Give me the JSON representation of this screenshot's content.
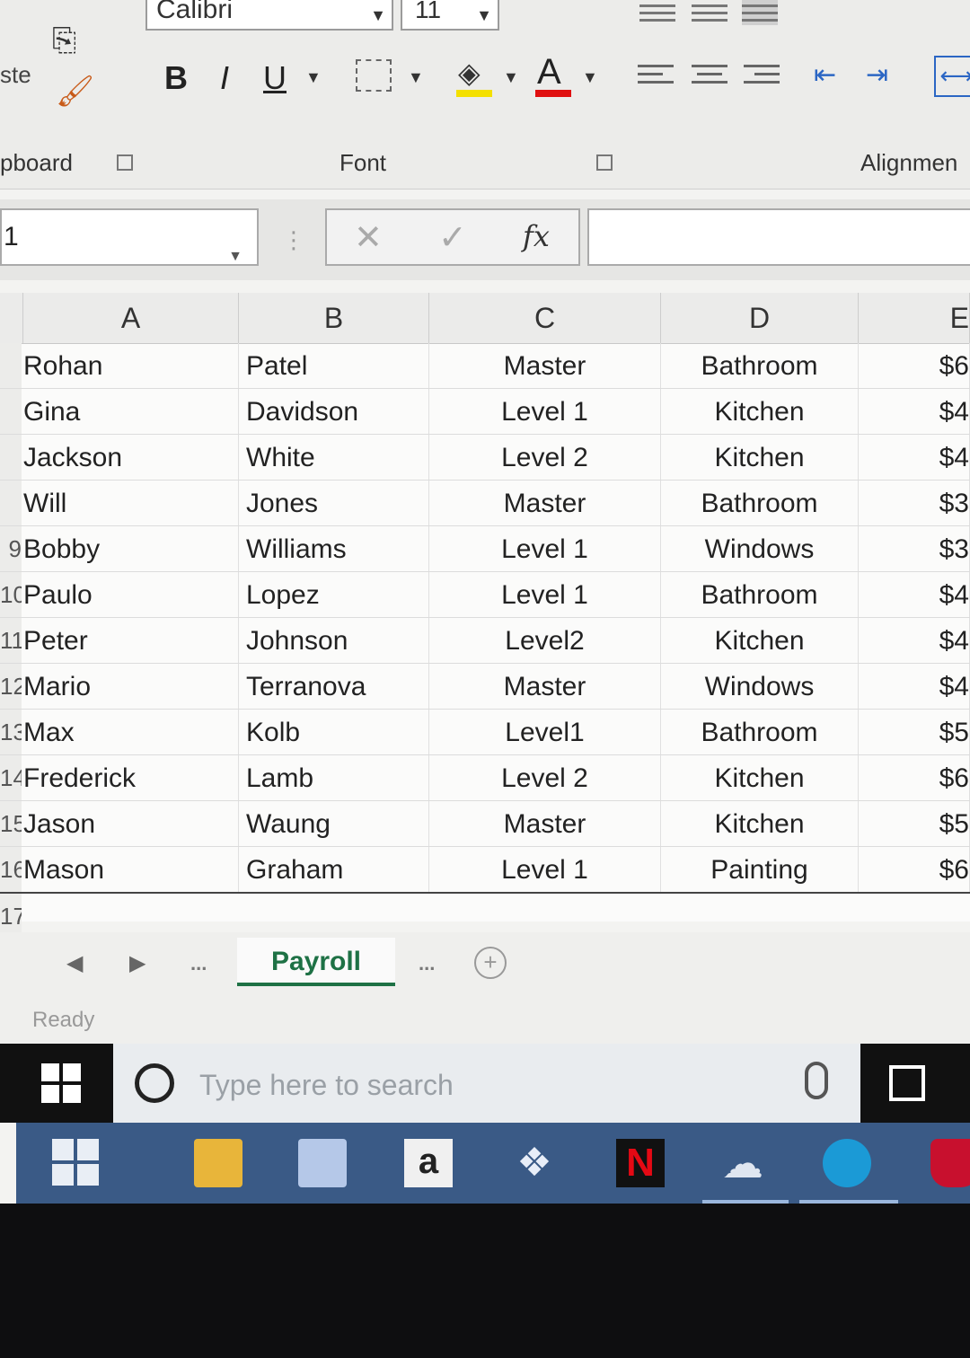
{
  "ribbon": {
    "font_name": "Calibri",
    "font_size": "11",
    "paste_label": "ste",
    "bold_label": "B",
    "italic_label": "I",
    "underline_label": "U",
    "font_color_label": "A",
    "wrap_label": "⟷",
    "groups": {
      "clipboard": "pboard",
      "font": "Font",
      "alignment": "Alignmen"
    }
  },
  "formula_bar": {
    "name_box": "1",
    "cancel": "✕",
    "enter": "✓",
    "fx": "fx",
    "value": ""
  },
  "columns": [
    "A",
    "B",
    "C",
    "D",
    "E"
  ],
  "rows": [
    {
      "num": "",
      "a": "Rohan",
      "b": "Patel",
      "c": "Master",
      "d": "Bathroom",
      "e": "$6"
    },
    {
      "num": "",
      "a": "Gina",
      "b": "Davidson",
      "c": "Level 1",
      "d": "Kitchen",
      "e": "$4"
    },
    {
      "num": "",
      "a": "Jackson",
      "b": "White",
      "c": "Level 2",
      "d": "Kitchen",
      "e": "$4"
    },
    {
      "num": "",
      "a": "Will",
      "b": "Jones",
      "c": "Master",
      "d": "Bathroom",
      "e": "$3"
    },
    {
      "num": "9",
      "a": "Bobby",
      "b": "Williams",
      "c": "Level 1",
      "d": "Windows",
      "e": "$3"
    },
    {
      "num": "10",
      "a": "Paulo",
      "b": "Lopez",
      "c": "Level 1",
      "d": "Bathroom",
      "e": "$4"
    },
    {
      "num": "11",
      "a": "Peter",
      "b": "Johnson",
      "c": "Level2",
      "d": "Kitchen",
      "e": "$4"
    },
    {
      "num": "12",
      "a": "Mario",
      "b": "Terranova",
      "c": "Master",
      "d": "Windows",
      "e": "$4"
    },
    {
      "num": "13",
      "a": "Max",
      "b": "Kolb",
      "c": "Level1",
      "d": "Bathroom",
      "e": "$5"
    },
    {
      "num": "14",
      "a": "Frederick",
      "b": "Lamb",
      "c": "Level 2",
      "d": "Kitchen",
      "e": "$6"
    },
    {
      "num": "15",
      "a": "Jason",
      "b": "Waung",
      "c": "Master",
      "d": "Kitchen",
      "e": "$5"
    },
    {
      "num": "16",
      "a": "Mason",
      "b": "Graham",
      "c": "Level 1",
      "d": "Painting",
      "e": "$6"
    }
  ],
  "empty_row_num": "17",
  "sheet_tabs": {
    "nav_prev": "◀",
    "nav_next": "▶",
    "ellipsis_left": "...",
    "active_tab": "Payroll",
    "ellipsis_right": "...",
    "add": "+"
  },
  "status": "Ready",
  "taskbar": {
    "search_placeholder": "Type here to search",
    "amazon_letter": "a",
    "netflix_letter": "N"
  },
  "colors": {
    "excel_green": "#1e7145",
    "fill_yellow": "#f4e000",
    "font_red": "#e01010",
    "taskbar_blue": "#3a5a86"
  }
}
